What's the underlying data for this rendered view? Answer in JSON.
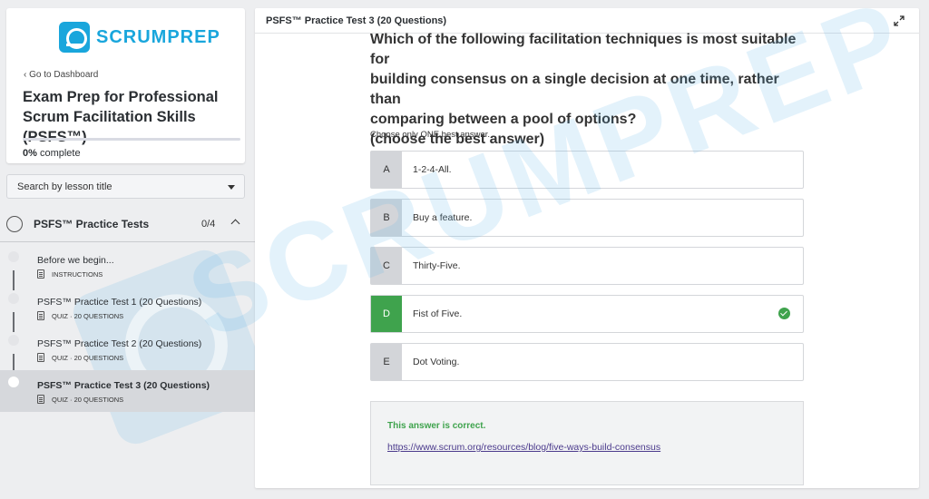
{
  "brand": {
    "name": "SCRUMPREP",
    "color": "#19a6dc"
  },
  "sidebar": {
    "back_label": "‹ Go to Dashboard",
    "course_title": "Exam Prep for Professional Scrum Facilitation Skills (PSFS™)",
    "progress": {
      "value": "0%",
      "label": "complete",
      "fraction": 0
    },
    "search_placeholder": "Search by lesson title",
    "section": {
      "title": "PSFS™ Practice Tests",
      "count": "0/4"
    },
    "lessons": [
      {
        "title": "Before we begin...",
        "meta": "INSTRUCTIONS"
      },
      {
        "title": "PSFS™ Practice Test 1 (20 Questions)",
        "meta": "QUIZ · 20 QUESTIONS"
      },
      {
        "title": "PSFS™ Practice Test 2 (20 Questions)",
        "meta": "QUIZ · 20 QUESTIONS"
      },
      {
        "title": "PSFS™ Practice Test 3 (20 Questions)",
        "meta": "QUIZ · 20 QUESTIONS",
        "active": true
      }
    ]
  },
  "main": {
    "title": "PSFS™ Practice Test 3 (20 Questions)",
    "question_line1": "Which of the following facilitation techniques is most suitable for",
    "question_line2": "building consensus on a single decision at one time, rather than",
    "question_line3": "comparing between a pool of options?",
    "question_line4": "(choose the best answer)",
    "instruction": "Choose only ONE best answer.",
    "options": [
      {
        "letter": "A",
        "text": "1-2-4-All."
      },
      {
        "letter": "B",
        "text": "Buy a feature."
      },
      {
        "letter": "C",
        "text": "Thirty-Five."
      },
      {
        "letter": "D",
        "text": "Fist of Five.",
        "selected": true,
        "correct": true
      },
      {
        "letter": "E",
        "text": "Dot Voting."
      }
    ],
    "feedback": {
      "status": "This answer is correct.",
      "link": "https://www.scrum.org/resources/blog/five-ways-build-consensus"
    }
  },
  "colors": {
    "correct": "#3fa34d",
    "accent": "#19a6dc",
    "link": "#4b3a8c"
  },
  "icons": {
    "logo": "scrumprep-logo-icon",
    "expand": "expand-icon",
    "lesson_doc": "document-icon",
    "check": "check-circle-icon",
    "chevron": "chevron-up-icon",
    "caret": "caret-down-icon"
  }
}
